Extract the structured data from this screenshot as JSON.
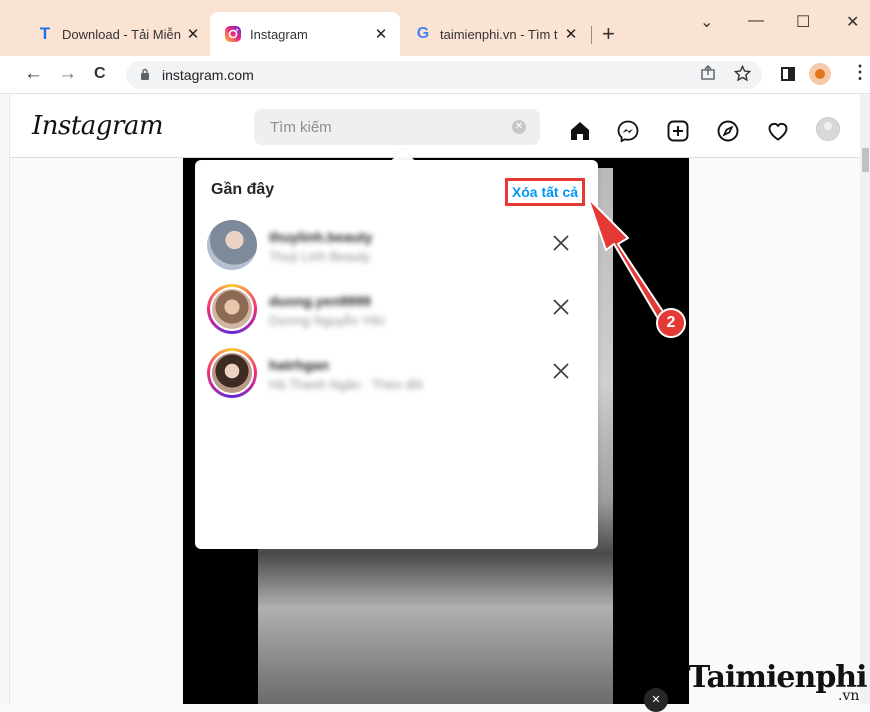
{
  "browser": {
    "tabs": [
      {
        "title": "Download - Tải Miễn",
        "favicon": "T",
        "favicon_color": "#1a73e8"
      },
      {
        "title": "Instagram",
        "favicon": "instagram-logo",
        "active": true
      },
      {
        "title": "taimienphi.vn - Tìm t",
        "favicon": "G"
      }
    ],
    "close_glyph": "✕",
    "new_tab_glyph": "+",
    "window_controls": {
      "dropdown": "⌄",
      "minimize": "—",
      "maximize": "☐",
      "close": "✕"
    },
    "address": "instagram.com",
    "nav": {
      "back": "←",
      "forward": "→",
      "reload": "C"
    }
  },
  "instagram": {
    "logo_text": "Instagram",
    "search_placeholder": "Tìm kiếm",
    "search_clear_glyph": "✕",
    "nav_icons": [
      "home-icon",
      "messenger-icon",
      "new-post-icon",
      "explore-icon",
      "activity-heart-icon",
      "profile-avatar"
    ]
  },
  "recent": {
    "heading": "Gần đây",
    "clear_all_label": "Xóa tất cả",
    "items": [
      {
        "name": "thuylinh.beauty",
        "subtitle": "Thuỳ Linh Beauty",
        "story_ring": false
      },
      {
        "name": "duong.yen9999",
        "subtitle": "Dương Nguyễn Yến",
        "story_ring": true
      },
      {
        "name": "hatrhgan",
        "subtitle": "Hà Thanh Ngân · Theo dõi",
        "story_ring": true
      }
    ]
  },
  "annotation": {
    "step_number": "2",
    "color": "#e53935"
  },
  "watermark": {
    "brand": "Taimienphi",
    "suffix": ".vn"
  },
  "colors": {
    "accent_blue": "#0095f6",
    "tab_bar": "#fbe3d3"
  }
}
